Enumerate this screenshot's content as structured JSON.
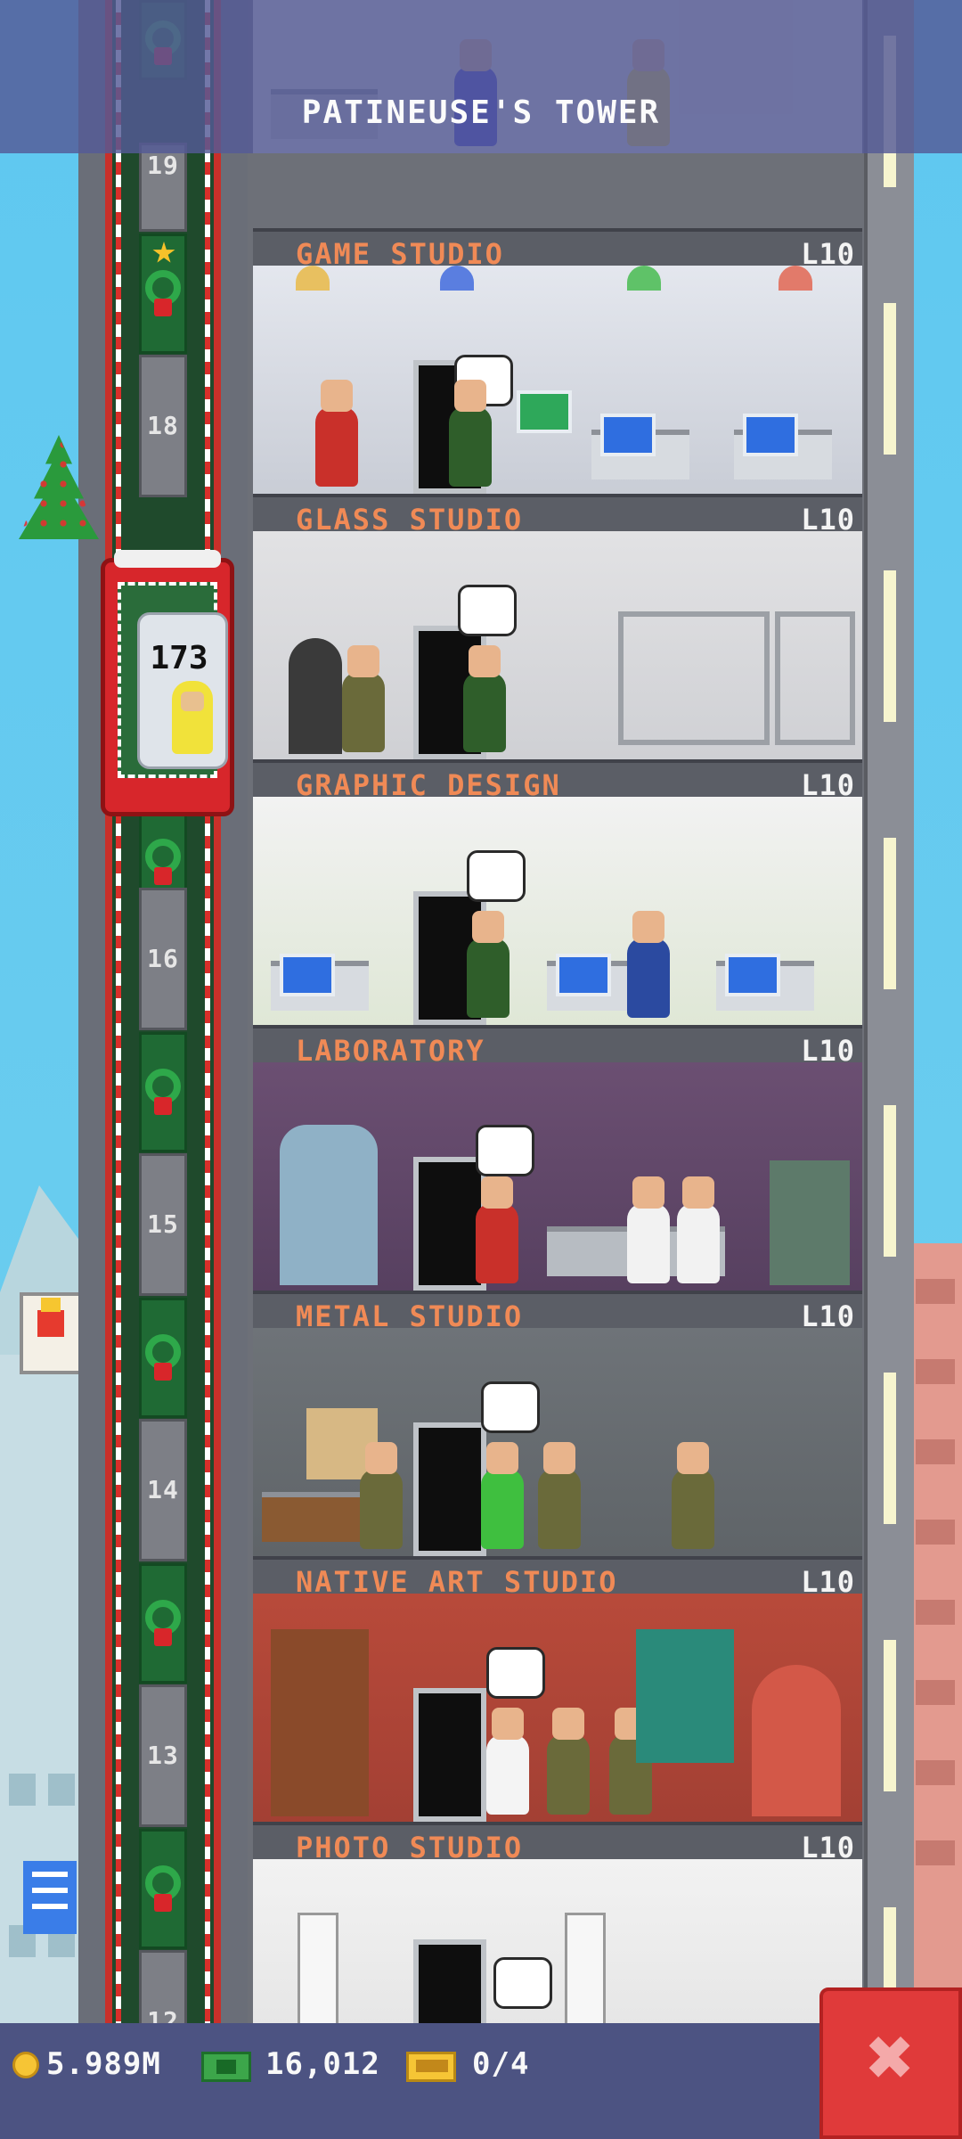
{
  "header": {
    "tower_name": "PATINEUSE'S TOWER"
  },
  "elevator": {
    "passenger_destination": "173",
    "floor_numbers": [
      "19",
      "18",
      "16",
      "15",
      "14",
      "13",
      "12"
    ]
  },
  "floors": [
    {
      "name": "GAME STUDIO",
      "level": "L10"
    },
    {
      "name": "GLASS STUDIO",
      "level": "L10"
    },
    {
      "name": "GRAPHIC DESIGN",
      "level": "L10"
    },
    {
      "name": "LABORATORY",
      "level": "L10"
    },
    {
      "name": "METAL STUDIO",
      "level": "L10"
    },
    {
      "name": "NATIVE ART STUDIO",
      "level": "L10"
    },
    {
      "name": "PHOTO STUDIO",
      "level": "L10"
    }
  ],
  "resources": {
    "coins": "5.989M",
    "bux": "16,012",
    "tickets": "0/4"
  },
  "icons": {
    "coin": "coin-icon",
    "bux": "bux-icon",
    "ticket": "vip-ticket-icon",
    "close": "close-x-icon"
  },
  "colors": {
    "label_text": "#f08a56",
    "close_button": "#e03a3a",
    "elevator": "#d7262b",
    "resource_bar": "#4c5382"
  }
}
